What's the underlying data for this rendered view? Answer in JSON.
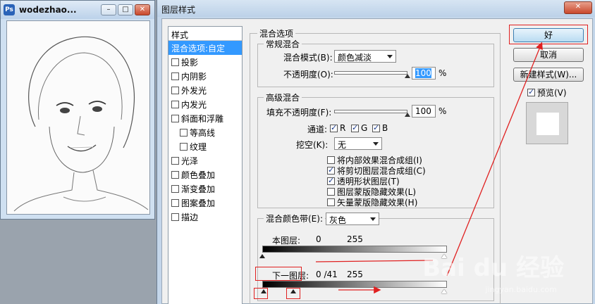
{
  "doc_window": {
    "title": "wodezhao..."
  },
  "dialog": {
    "title": "图层样式"
  },
  "style_list": {
    "header": "样式",
    "items": [
      {
        "label": "混合选项:自定",
        "selected": true,
        "checkbox": false,
        "indent": false
      },
      {
        "label": "投影",
        "checkbox": true,
        "indent": false
      },
      {
        "label": "内阴影",
        "checkbox": true,
        "indent": false
      },
      {
        "label": "外发光",
        "checkbox": true,
        "indent": false
      },
      {
        "label": "内发光",
        "checkbox": true,
        "indent": false
      },
      {
        "label": "斜面和浮雕",
        "checkbox": true,
        "indent": false
      },
      {
        "label": "等高线",
        "checkbox": true,
        "indent": true
      },
      {
        "label": "纹理",
        "checkbox": true,
        "indent": true
      },
      {
        "label": "光泽",
        "checkbox": true,
        "indent": false
      },
      {
        "label": "颜色叠加",
        "checkbox": true,
        "indent": false
      },
      {
        "label": "渐变叠加",
        "checkbox": true,
        "indent": false
      },
      {
        "label": "图案叠加",
        "checkbox": true,
        "indent": false
      },
      {
        "label": "描边",
        "checkbox": true,
        "indent": false
      }
    ]
  },
  "blend_options": {
    "group_title": "混合选项",
    "general": {
      "title": "常规混合",
      "mode_label": "混合模式(B):",
      "mode_value": "颜色减淡",
      "opacity_label": "不透明度(O):",
      "opacity_value": "100",
      "percent": "%"
    },
    "advanced": {
      "title": "高级混合",
      "fill_label": "填充不透明度(F):",
      "fill_value": "100",
      "percent": "%",
      "channels_label": "通道:",
      "channel_r": "R",
      "channel_g": "G",
      "channel_b": "B",
      "knockout_label": "挖空(K):",
      "knockout_value": "无",
      "options": [
        {
          "label": "将内部效果混合成组(I)",
          "checked": false
        },
        {
          "label": "将剪切图层混合成组(C)",
          "checked": true
        },
        {
          "label": "透明形状图层(T)",
          "checked": true
        },
        {
          "label": "图层蒙版隐藏效果(L)",
          "checked": false
        },
        {
          "label": "矢量蒙版隐藏效果(H)",
          "checked": false
        }
      ]
    },
    "blend_if": {
      "label": "混合颜色带(E):",
      "value": "灰色",
      "this_layer_label": "本图层:",
      "this_layer_low": "0",
      "this_layer_high": "255",
      "underlying_label": "下一图层:",
      "underlying_low": "0 /41",
      "underlying_high": "255"
    }
  },
  "right_panel": {
    "ok_label": "好",
    "cancel_label": "取消",
    "new_style_label": "新建样式(W)...",
    "preview_label": "预览(V)"
  },
  "watermark": {
    "text": "Bai du 经验",
    "sub": "jingyan.baidu.com"
  },
  "colors": {
    "accent": "#3399ff",
    "annotation_red": "#e02020"
  }
}
